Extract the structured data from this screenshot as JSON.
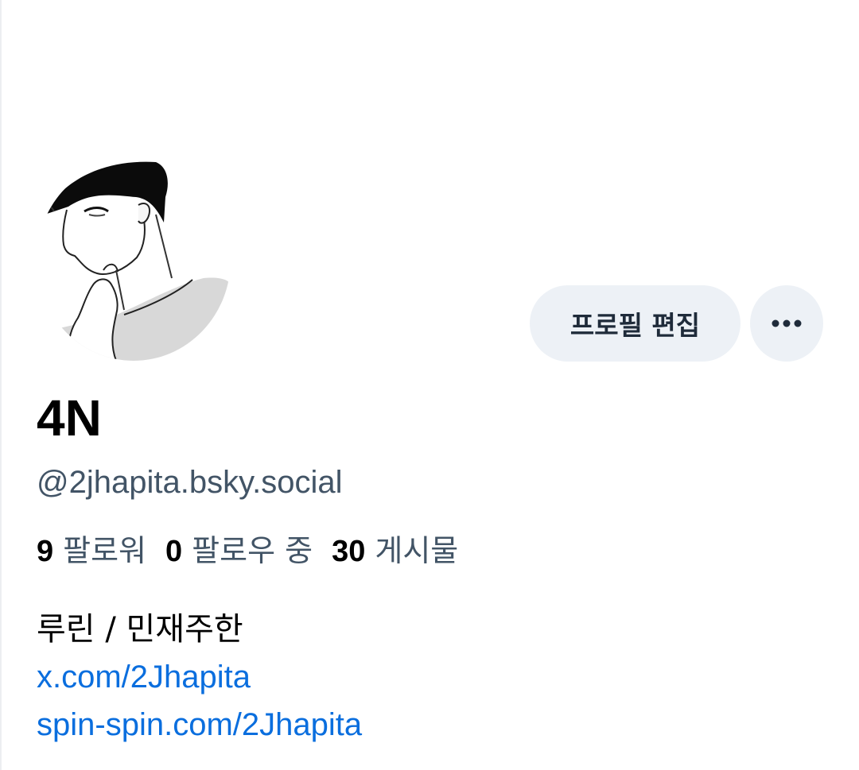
{
  "profile": {
    "display_name": "4N",
    "handle": "@2jhapita.bsky.social",
    "edit_label": "프로필 편집",
    "more_icon": "ellipsis-horizontal-icon",
    "avatar_icon": "avatar-drawing"
  },
  "stats": [
    {
      "count": "9",
      "label": "팔로워"
    },
    {
      "count": "0",
      "label": "팔로우 중"
    },
    {
      "count": "30",
      "label": "게시물"
    }
  ],
  "bio": {
    "text": "루린 / 민재주한",
    "links": [
      "x.com/2Jhapita",
      "spin-spin.com/2Jhapita"
    ]
  },
  "colors": {
    "button_bg": "#edf1f6",
    "secondary_text": "#425466",
    "link": "#0a6ede"
  }
}
